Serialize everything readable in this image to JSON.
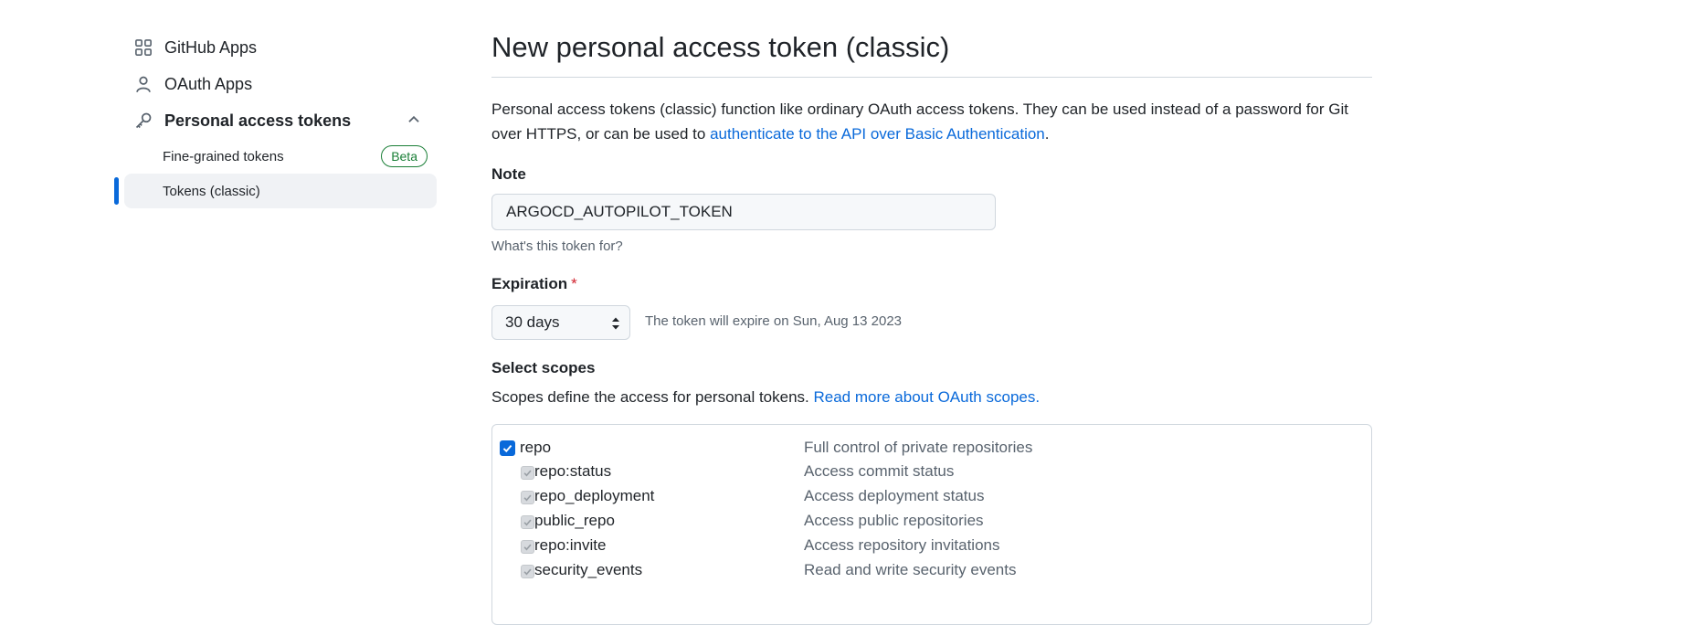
{
  "sidebar": {
    "items": [
      {
        "label": "GitHub Apps",
        "icon": "apps-grid-icon"
      },
      {
        "label": "OAuth Apps",
        "icon": "person-icon"
      },
      {
        "label": "Personal access tokens",
        "icon": "key-icon",
        "expanded": true
      }
    ],
    "subitems": [
      {
        "label": "Fine-grained tokens",
        "badge": "Beta"
      },
      {
        "label": "Tokens (classic)",
        "active": true
      }
    ]
  },
  "main": {
    "title": "New personal access token (classic)",
    "intro_text": "Personal access tokens (classic) function like ordinary OAuth access tokens. They can be used instead of a password for Git over HTTPS, or can be used to ",
    "intro_link": "authenticate to the API over Basic Authentication",
    "intro_end": ".",
    "note": {
      "label": "Note",
      "value": "ARGOCD_AUTOPILOT_TOKEN",
      "hint": "What's this token for?"
    },
    "expiration": {
      "label": "Expiration",
      "required_mark": "*",
      "selected": "30 days",
      "hint": "The token will expire on Sun, Aug 13 2023"
    },
    "scopes": {
      "label": "Select scopes",
      "description": "Scopes define the access for personal tokens. ",
      "link": "Read more about OAuth scopes.",
      "rows": [
        {
          "name": "repo",
          "desc": "Full control of private repositories",
          "checked": true,
          "sub": false
        },
        {
          "name": "repo:status",
          "desc": "Access commit status",
          "checked": true,
          "sub": true
        },
        {
          "name": "repo_deployment",
          "desc": "Access deployment status",
          "checked": true,
          "sub": true
        },
        {
          "name": "public_repo",
          "desc": "Access public repositories",
          "checked": true,
          "sub": true
        },
        {
          "name": "repo:invite",
          "desc": "Access repository invitations",
          "checked": true,
          "sub": true
        },
        {
          "name": "security_events",
          "desc": "Read and write security events",
          "checked": true,
          "sub": true
        }
      ]
    }
  },
  "colors": {
    "accent": "#0969da",
    "success": "#1a7f37",
    "danger": "#d1242f",
    "muted": "#59636e",
    "border": "#d0d7de"
  }
}
